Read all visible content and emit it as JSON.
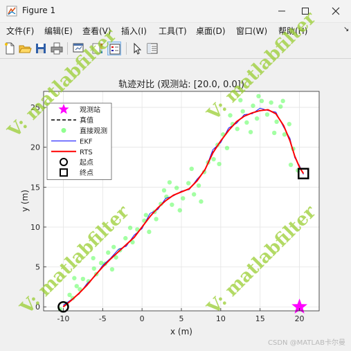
{
  "window": {
    "title": "Figure 1",
    "minimize_icon": "minimize-icon",
    "maximize_icon": "maximize-icon",
    "close_icon": "close-icon"
  },
  "menu": [
    "文件(F)",
    "编辑(E)",
    "查看(V)",
    "插入(I)",
    "工具(T)",
    "桌面(D)",
    "窗口(W)",
    "帮助(H)"
  ],
  "toolbar_icons": [
    "new-figure-icon",
    "open-file-icon",
    "save-icon",
    "print-icon",
    "link-plot-icon",
    "insert-colorbar-icon",
    "insert-legend-icon",
    "edit-plot-icon",
    "property-inspector-icon"
  ],
  "watermark": {
    "text": "V: matlabfilter",
    "color": "#9acd32"
  },
  "footer": {
    "credit": "CSDN @MATLAB卡尔曼"
  },
  "chart_data": {
    "type": "line",
    "title": "轨迹对比 (观测站: [20.0, 0.0])",
    "xlabel": "x (m)",
    "ylabel": "y (m)",
    "xlim": [
      -12.5,
      22.5
    ],
    "ylim": [
      -0.5,
      27
    ],
    "xticks": [
      -10,
      -5,
      0,
      5,
      10,
      15,
      20
    ],
    "yticks": [
      0,
      5,
      10,
      15,
      20,
      25
    ],
    "grid": true,
    "legend_position": "top-left",
    "legend": [
      {
        "label": "观测站",
        "marker": "pentagram",
        "color": "#ff00ff"
      },
      {
        "label": "真值",
        "style": "dashed",
        "color": "#000000"
      },
      {
        "label": "直接观测",
        "marker": "dot",
        "color": "#33ff33"
      },
      {
        "label": "EKF",
        "style": "line",
        "color": "#0000ff"
      },
      {
        "label": "RTS",
        "style": "line",
        "color": "#ff0000"
      },
      {
        "label": "起点",
        "marker": "circle",
        "color": "#000000"
      },
      {
        "label": "终点",
        "marker": "square",
        "color": "#000000"
      }
    ],
    "station": {
      "x": 20.0,
      "y": 0.0
    },
    "start": {
      "x": -10.0,
      "y": 0.0
    },
    "end": {
      "x": 20.5,
      "y": 16.7
    },
    "true_path": {
      "x": [
        -10,
        -9,
        -8,
        -7,
        -6,
        -5,
        -4,
        -3,
        -2,
        -1,
        0,
        1,
        2,
        3,
        4,
        5,
        6,
        7,
        8,
        9,
        10,
        11,
        12,
        13,
        14,
        15,
        16,
        17,
        18,
        18.8,
        19.4,
        20,
        20.5
      ],
      "y": [
        0,
        0.8,
        1.7,
        2.7,
        3.9,
        5.0,
        6.0,
        6.9,
        7.8,
        8.7,
        10.0,
        11.3,
        12.4,
        13.3,
        14.0,
        14.4,
        14.8,
        15.8,
        17.2,
        19.4,
        20.8,
        22.1,
        23.2,
        23.9,
        24.3,
        24.6,
        24.7,
        24.2,
        22.7,
        20.8,
        18.9,
        17.5,
        16.7
      ]
    },
    "ekf_path": {
      "x": [
        -10,
        -9,
        -8,
        -7,
        -6,
        -5,
        -4,
        -3,
        -2,
        -1,
        0,
        1,
        2,
        3,
        4,
        5,
        6,
        7,
        8,
        9,
        10,
        11,
        12,
        13,
        14,
        15,
        16,
        17,
        18,
        18.8,
        19.4,
        20,
        20.5
      ],
      "y": [
        0.2,
        0.9,
        1.6,
        2.9,
        3.8,
        5.2,
        6.1,
        7.2,
        7.6,
        9.0,
        9.8,
        11.7,
        12.2,
        13.6,
        13.9,
        14.5,
        14.7,
        16.0,
        17.1,
        19.7,
        20.6,
        22.4,
        23.0,
        24.1,
        24.2,
        24.9,
        24.6,
        24.4,
        22.5,
        21.1,
        18.7,
        17.7,
        16.6
      ]
    },
    "rts_path": {
      "x": [
        -10,
        -9,
        -8,
        -7,
        -6,
        -5,
        -4,
        -3,
        -2,
        -1,
        0,
        1,
        2,
        3,
        4,
        5,
        6,
        7,
        8,
        9,
        10,
        11,
        12,
        13,
        14,
        15,
        16,
        17,
        18,
        18.8,
        19.4,
        20,
        20.5
      ],
      "y": [
        0,
        0.8,
        1.7,
        2.7,
        3.9,
        5.0,
        6.0,
        6.9,
        7.8,
        8.7,
        10.0,
        11.3,
        12.4,
        13.3,
        14.0,
        14.4,
        14.8,
        15.8,
        17.2,
        19.3,
        20.8,
        22.1,
        23.2,
        23.9,
        24.3,
        24.6,
        24.7,
        24.2,
        22.7,
        20.8,
        18.9,
        17.5,
        16.7
      ]
    },
    "observations": {
      "x": [
        -10.4,
        -9.2,
        -9.6,
        -8.3,
        -8.8,
        -7.5,
        -6.8,
        -7.9,
        -6.1,
        -5.2,
        -5.8,
        -4.3,
        -3.6,
        -4.7,
        -2.8,
        -2.1,
        -3.3,
        -1.2,
        -0.6,
        0.3,
        0.9,
        1.6,
        2.4,
        1.8,
        3.1,
        3.8,
        4.4,
        5.2,
        5.9,
        6.6,
        7.2,
        7.9,
        8.4,
        9.1,
        9.6,
        10.3,
        10.8,
        11.5,
        12.1,
        12.8,
        13.3,
        14.1,
        14.6,
        15.2,
        15.9,
        16.4,
        17.1,
        17.6,
        18.1,
        18.7,
        19.2,
        19.8,
        -6.2,
        0.5,
        6.3,
        12.5,
        16.8,
        9.8,
        3.5,
        -3.8,
        -8.6,
        14.8,
        18.9,
        11.2,
        7.5,
        4.8,
        -1.5,
        2.8,
        13.8,
        17.9
      ],
      "y": [
        -0.3,
        1.5,
        0.4,
        2.6,
        1.1,
        3.5,
        3.2,
        2.2,
        4.8,
        5.5,
        4.1,
        6.8,
        7.5,
        5.4,
        7.1,
        8.6,
        6.2,
        8.1,
        9.7,
        10.8,
        9.4,
        11.9,
        12.9,
        11.0,
        13.8,
        12.8,
        14.9,
        13.6,
        15.5,
        14.1,
        15.2,
        16.9,
        18.1,
        18.5,
        20.3,
        21.6,
        19.9,
        22.9,
        22.3,
        24.5,
        23.1,
        25.2,
        23.6,
        25.8,
        24.1,
        25.6,
        23.2,
        25.1,
        21.6,
        22.9,
        19.8,
        17.1,
        6.1,
        11.5,
        17.3,
        25.9,
        21.8,
        17.9,
        15.6,
        4.7,
        3.6,
        26.4,
        17.8,
        24.0,
        13.2,
        12.1,
        9.9,
        14.6,
        21.9,
        25.8
      ]
    }
  }
}
